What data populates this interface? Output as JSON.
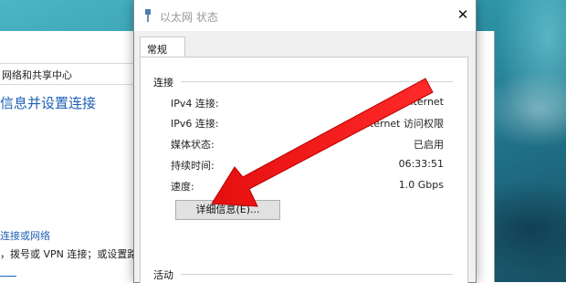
{
  "back_window": {
    "address_text": "网络和共享中心",
    "title": "信息并设置连接",
    "link_text": "连接或网络",
    "description": "，拨号或 VPN 连接；或设置路由"
  },
  "dialog": {
    "title": "以太网 状态",
    "tabs": [
      {
        "label": "常规"
      }
    ],
    "connection_group": {
      "title": "连接",
      "rows": [
        {
          "label": "IPv4 连接:",
          "value": "Internet"
        },
        {
          "label": "IPv6 连接:",
          "value": "Internet 访问权限"
        },
        {
          "label": "媒体状态:",
          "value": "已启用"
        },
        {
          "label": "持续时间:",
          "value": "06:33:51"
        },
        {
          "label": "速度:",
          "value": "1.0 Gbps"
        }
      ],
      "details_button": "详细信息(E)..."
    },
    "activity_group": {
      "title": "活动"
    }
  },
  "colors": {
    "link_blue": "#1e5fb4",
    "annotation_red": "#f21a1a",
    "desktop_teal": "#2d92a6"
  },
  "icons": {
    "title_icon": "network-cable-icon",
    "close": "close-icon",
    "search": "search-icon"
  }
}
